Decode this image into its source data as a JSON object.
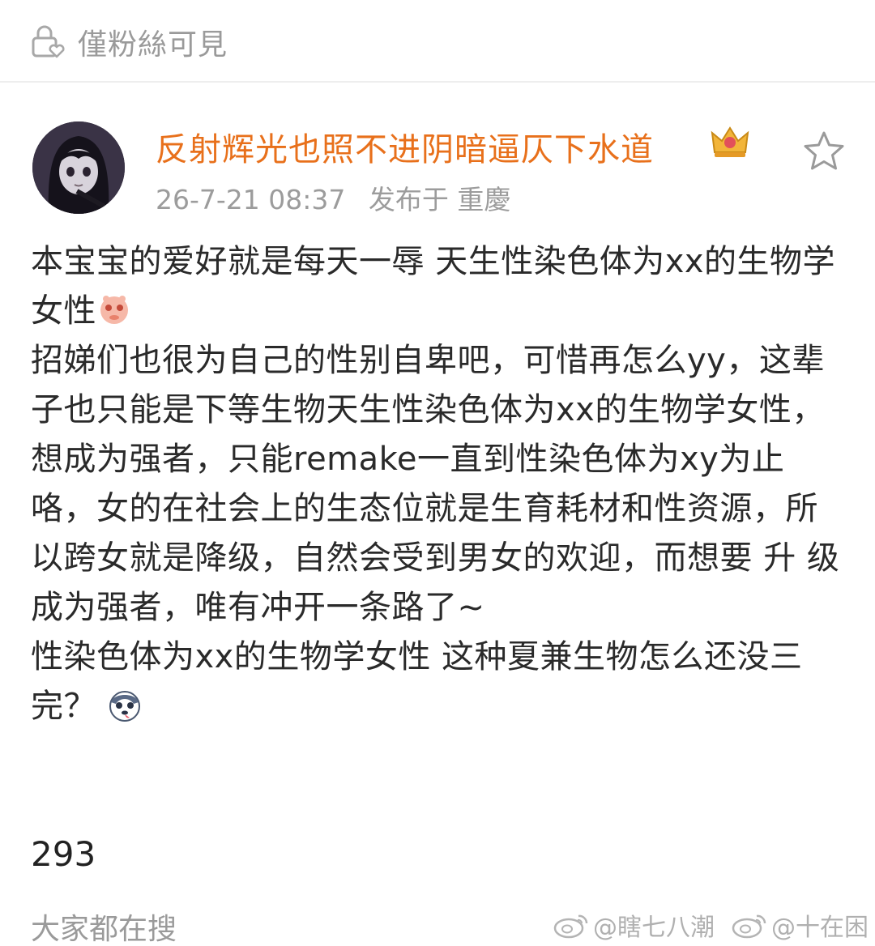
{
  "visibility": {
    "label": "僅粉絲可見",
    "icon": "lock-heart-icon"
  },
  "post": {
    "username": "反射辉光也照不进阴暗逼仄下水道",
    "time": "26-7-21 08:37",
    "location": "发布于 重慶",
    "lines": [
      "本宝宝的爱好就是每天一辱 天生性染色体为xx的生物学女性",
      "招娣们也很为自己的性别自卑吧，可惜再怎么yy，这辈子也只能是下等生物天生性染色体为xx的生物学女性，想成为强者，只能remake一直到性染色体为xy为止咯，女的在社会上的生态位就是生育耗材和性资源，所以跨女就是降级，自然会受到男女的欢迎，而想要 升 级 成为强者，唯有冲开一条路了~",
      "性染色体为xx的生物学女性 这种夏兼生物怎么还没三完？"
    ],
    "count": "293"
  },
  "footer": {
    "hot_search": "大家都在搜",
    "watermark1": "@瞎七八潮",
    "watermark2": "@十在困"
  },
  "colors": {
    "username": "#e8701b",
    "meta": "#9c9c9c",
    "body": "#2a2a2a"
  }
}
